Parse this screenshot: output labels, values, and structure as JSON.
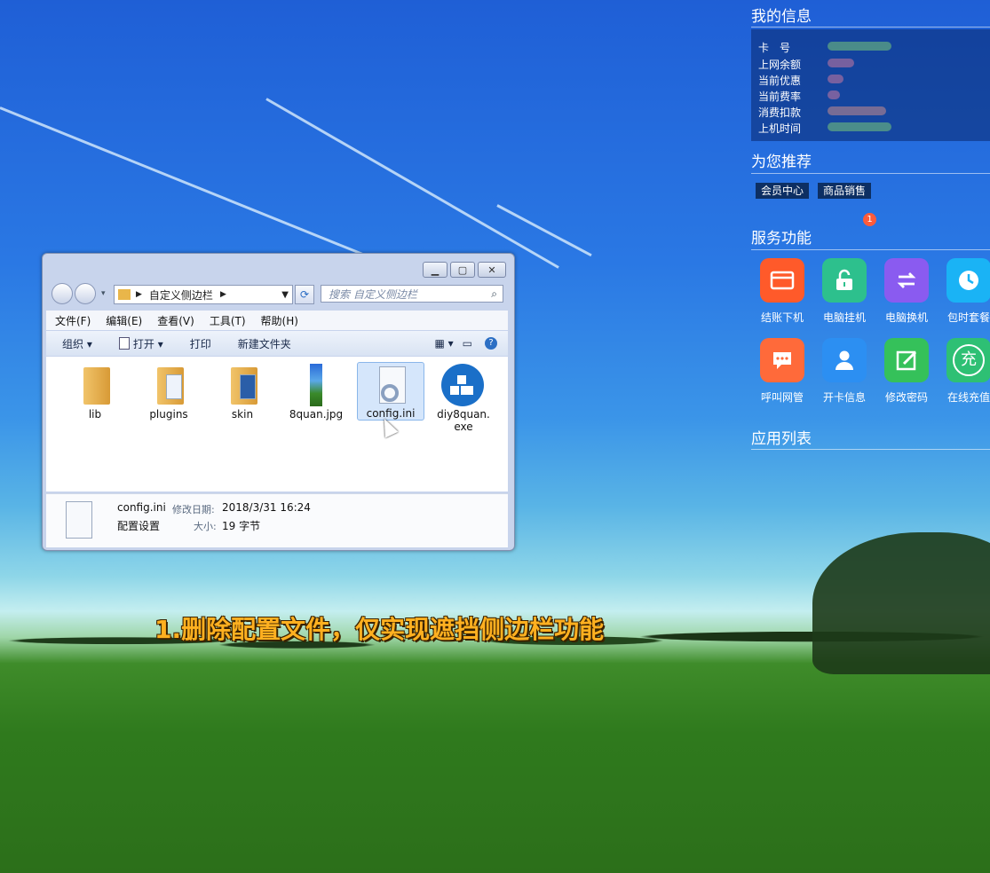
{
  "sidebar": {
    "my_info": {
      "title": "我的信息",
      "rows": [
        "卡　号",
        "上网余额",
        "当前优惠",
        "当前费率",
        "消费扣款",
        "上机时间"
      ]
    },
    "recommend": {
      "title": "为您推荐",
      "chips": [
        "会员中心",
        "商品销售"
      ]
    },
    "services": {
      "title": "服务功能",
      "badge": "1",
      "items": [
        {
          "label": "结账下机",
          "icon": "wallet-icon",
          "color": "#ff5a2a"
        },
        {
          "label": "电脑挂机",
          "icon": "unlock-icon",
          "color": "#2dc08d"
        },
        {
          "label": "电脑换机",
          "icon": "swap-icon",
          "color": "#8a5bf0"
        },
        {
          "label": "包时套餐",
          "icon": "clock-icon",
          "color": "#1ab3f5"
        },
        {
          "label": "呼叫网管",
          "icon": "chat-icon",
          "color": "#ff6a3a"
        },
        {
          "label": "开卡信息",
          "icon": "person-icon",
          "color": "#2c8ff2"
        },
        {
          "label": "修改密码",
          "icon": "edit-icon",
          "color": "#35c15a"
        },
        {
          "label": "在线充值",
          "icon": "recharge-icon",
          "color": "#2ec074"
        }
      ],
      "recharge_glyph": "充"
    },
    "apps": {
      "title": "应用列表"
    }
  },
  "explorer": {
    "address": "自定义侧边栏",
    "search_placeholder": "搜索 自定义侧边栏",
    "menu": [
      "文件(F)",
      "编辑(E)",
      "查看(V)",
      "工具(T)",
      "帮助(H)"
    ],
    "toolbar": {
      "organize": "组织",
      "open": "打开",
      "print": "打印",
      "new_folder": "新建文件夹"
    },
    "files": [
      {
        "name": "lib",
        "kind": "folder"
      },
      {
        "name": "plugins",
        "kind": "folder"
      },
      {
        "name": "skin",
        "kind": "folder"
      },
      {
        "name": "8quan.jpg",
        "kind": "image"
      },
      {
        "name": "config.ini",
        "kind": "ini",
        "selected": true
      },
      {
        "name": "diy8quan.\nexe",
        "kind": "exe"
      }
    ],
    "details": {
      "name": "config.ini",
      "modified_label": "修改日期:",
      "modified_value": "2018/3/31 16:24",
      "type": "配置设置",
      "size_label": "大小:",
      "size_value": "19 字节"
    }
  },
  "caption": "1.删除配置文件，仅实现遮挡侧边栏功能"
}
